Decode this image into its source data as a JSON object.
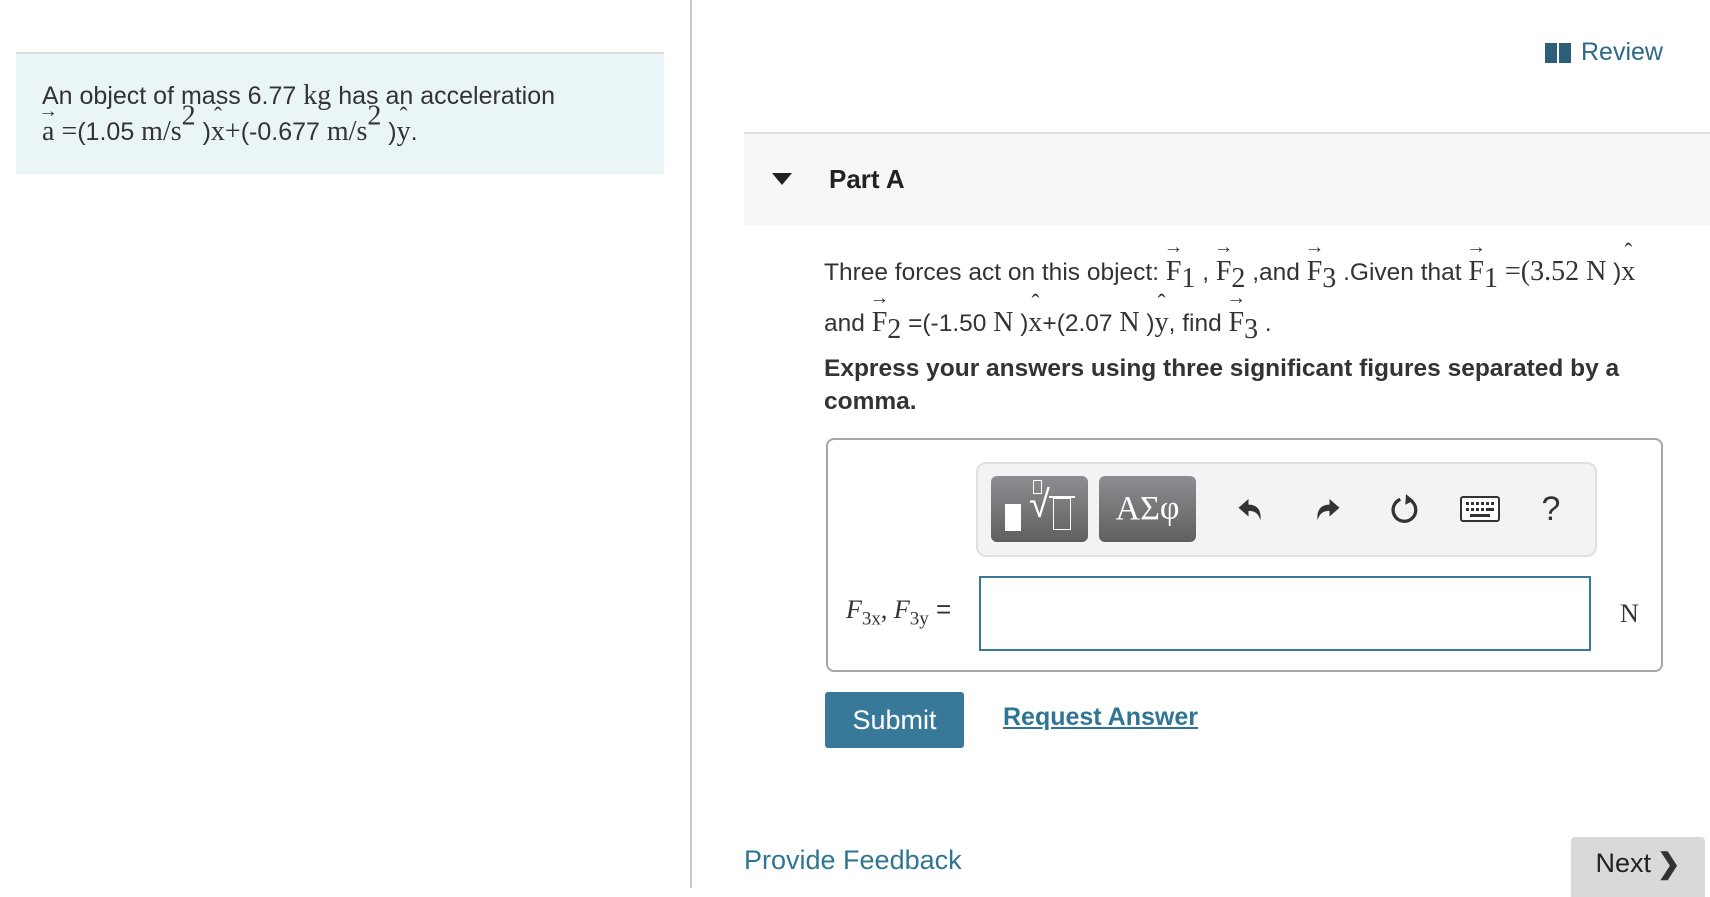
{
  "intro": {
    "line1_pre": "An object of mass 6.77 ",
    "mass_unit": "kg",
    "line1_post": " has an acceleration",
    "accel_symbol": "a",
    "equals": " =",
    "ax_value": "(1.05 ",
    "accel_unit": "m/s",
    "unit_exp": "2",
    "close_x": " )",
    "x_hat": "x",
    "plus": "+",
    "ay_value": "(-0.677 ",
    "close_y": " )",
    "y_hat": "y",
    "period": "."
  },
  "review": {
    "label": "Review",
    "icon": "book-icon"
  },
  "part": {
    "title": "Part A",
    "toggle_icon": "triangle-down-icon"
  },
  "problem": {
    "t1": "Three forces act on this object: ",
    "F": "F",
    "sub1": "1",
    "sub2": "2",
    "sub3": "3",
    "comma": " , ",
    "and1": " ,and ",
    "given": " .Given that ",
    "f1_eq": " =(3.52 ",
    "N": "N",
    "close": " )",
    "x_hat": "x",
    "y_hat": "y",
    "and2": "and ",
    "f2_eq": " =(-1.50 ",
    "plus_open": "+(2.07 ",
    "find": ", find ",
    "period": " ."
  },
  "instructions": "Express your answers using three significant figures separated by a comma.",
  "answer": {
    "label_F": "F",
    "label_sub_x": "3x",
    "label_sep": ", ",
    "label_sub_y": "3y",
    "label_eq": " =",
    "input_value": "",
    "unit": "N",
    "toolbar": {
      "templates_icon": "math-templates-icon",
      "symbols_label": "ΑΣφ",
      "undo_icon": "undo-icon",
      "redo_icon": "redo-icon",
      "reset_icon": "reset-icon",
      "keyboard_icon": "keyboard-icon",
      "help_label": "?"
    }
  },
  "actions": {
    "submit": "Submit",
    "request_answer": "Request Answer"
  },
  "footer": {
    "feedback": "Provide Feedback",
    "next": "Next",
    "next_icon": "❯"
  },
  "colors": {
    "accent": "#38799a",
    "link": "#2f7595",
    "intro_bg": "#eaf5f8",
    "part_bg": "#f7f7f7"
  }
}
